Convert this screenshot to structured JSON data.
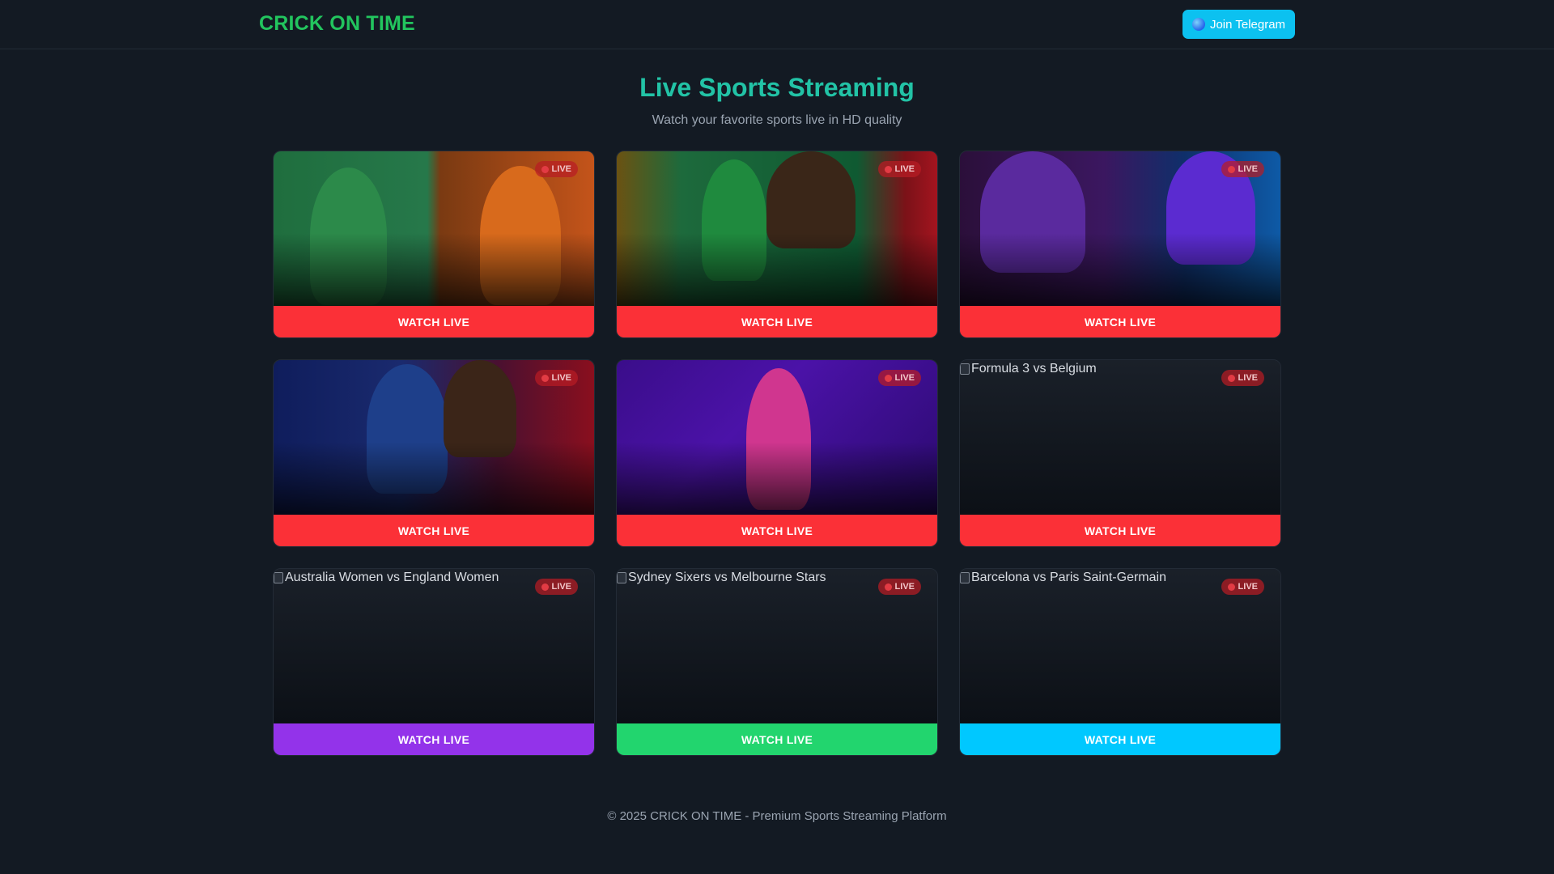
{
  "header": {
    "brand": "CRICK ON TIME",
    "telegram_label": "Join Telegram"
  },
  "hero": {
    "title": "Live Sports Streaming",
    "subtitle": "Watch your favorite sports live in HD quality"
  },
  "live_label": "LIVE",
  "watch_label": "WATCH LIVE",
  "cards": [
    {
      "alt": "",
      "image": "cricket-match-thumbnail",
      "button_color": "#fb3037"
    },
    {
      "alt": "",
      "image": "cricket-match-thumbnail",
      "button_color": "#fb3037"
    },
    {
      "alt": "",
      "image": "cricket-match-thumbnail",
      "button_color": "#fb3037"
    },
    {
      "alt": "",
      "image": "cricket-match-thumbnail",
      "button_color": "#fb3037"
    },
    {
      "alt": "",
      "image": "golf-thumbnail",
      "button_color": "#fb3037"
    },
    {
      "alt": "Formula 3 vs Belgium",
      "image": "broken-image",
      "button_color": "#fb3037"
    },
    {
      "alt": "Australia Women vs England Women",
      "image": "broken-image",
      "button_color": "#9333ea"
    },
    {
      "alt": "Sydney Sixers vs Melbourne Stars",
      "image": "broken-image",
      "button_color": "#22d56e"
    },
    {
      "alt": "Barcelona vs Paris Saint-Germain",
      "image": "broken-image",
      "button_color": "#00c8ff"
    }
  ],
  "footer": "© 2025 CRICK ON TIME - Premium Sports Streaming Platform",
  "colors": {
    "background": "#131a23",
    "brand": "#22c55e",
    "title": "#22c3a6",
    "telegram": "#0cc1f0"
  }
}
